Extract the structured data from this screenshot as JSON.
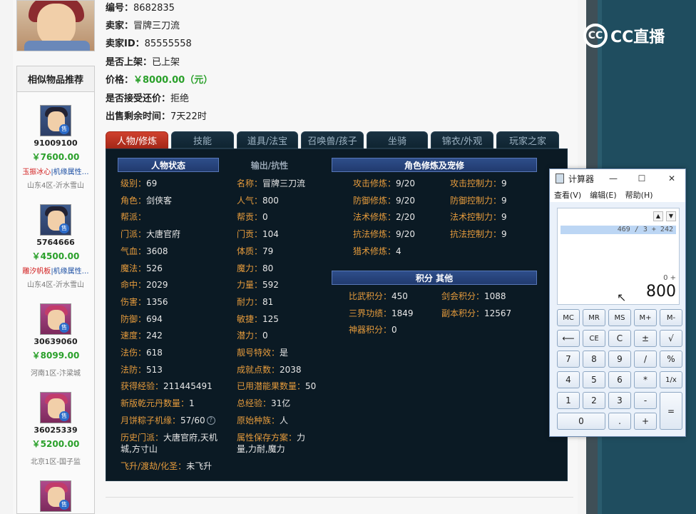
{
  "seller_info": {
    "id_label": "编号：",
    "id_value": "8682835",
    "seller_label": "卖家：",
    "seller_value": "冒牌三刀流",
    "seller_id_label": "卖家ID：",
    "seller_id_value": "85555558",
    "listed_label": "是否上架：",
    "listed_value": "已上架",
    "price_label": "价格：",
    "price_value": "￥8000.00（元）",
    "counter_label": "是否接受还价：",
    "counter_value": "拒绝",
    "time_label": "出售剩余时间：",
    "time_value": "7天22时"
  },
  "similar": {
    "title": "相似物品推荐",
    "items": [
      {
        "id": "91009100",
        "price": "￥7600.00",
        "desc_red": "玉振冰心",
        "desc_blue": "|机缘属性…",
        "server": "山东4区-沂水雪山"
      },
      {
        "id": "5764666",
        "price": "￥4500.00",
        "desc_red": "雕汐帆板",
        "desc_blue": "|机缘属性…",
        "server": "山东4区-沂水雪山"
      },
      {
        "id": "30639060",
        "price": "￥8099.00",
        "desc_red": "",
        "desc_blue": "",
        "server": "河南1区-汴梁城"
      },
      {
        "id": "36025339",
        "price": "￥5200.00",
        "desc_red": "",
        "desc_blue": "",
        "server": "北京1区-国子监"
      }
    ],
    "badge": "售"
  },
  "tabs": [
    "人物/修炼",
    "技能",
    "道具/法宝",
    "召唤兽/孩子",
    "坐骑",
    "锦衣/外观",
    "玩家之家"
  ],
  "sections": {
    "status": "人物状态",
    "output": "输出/抗性",
    "cultivation": "角色修炼及宠修",
    "points": "积分 其他"
  },
  "stats_left": [
    {
      "k": "级别：",
      "v": "69"
    },
    {
      "k": "角色：",
      "v": "剑侠客"
    },
    {
      "k": "帮派：",
      "v": ""
    },
    {
      "k": "门派：",
      "v": "大唐官府"
    },
    {
      "k": "气血：",
      "v": "3608"
    },
    {
      "k": "魔法：",
      "v": "526"
    },
    {
      "k": "命中：",
      "v": "2029"
    },
    {
      "k": "伤害：",
      "v": "1356"
    },
    {
      "k": "防御：",
      "v": "694"
    },
    {
      "k": "速度：",
      "v": "242"
    },
    {
      "k": "法伤：",
      "v": "618"
    },
    {
      "k": "法防：",
      "v": "513"
    },
    {
      "k": "获得经验：",
      "v": "211445491"
    },
    {
      "k": "新版乾元丹数量：",
      "v": "1"
    },
    {
      "k": "月饼粽子机缘：",
      "v": "57/60"
    }
  ],
  "stats_mid": [
    {
      "k": "名称：",
      "v": "冒牌三刀流"
    },
    {
      "k": "人气：",
      "v": "800"
    },
    {
      "k": "帮贡：",
      "v": "0"
    },
    {
      "k": "门贡：",
      "v": "104"
    },
    {
      "k": "体质：",
      "v": "79"
    },
    {
      "k": "魔力：",
      "v": "80"
    },
    {
      "k": "力量：",
      "v": "592"
    },
    {
      "k": "耐力：",
      "v": "81"
    },
    {
      "k": "敏捷：",
      "v": "125"
    },
    {
      "k": "潜力：",
      "v": "0"
    },
    {
      "k": "靓号特效：",
      "v": "是"
    },
    {
      "k": "成就点数：",
      "v": "2038"
    },
    {
      "k": "已用潜能果数量：",
      "v": "50"
    },
    {
      "k": "总经验：",
      "v": "31亿"
    },
    {
      "k": "原始种族：",
      "v": "人"
    }
  ],
  "history": {
    "k": "历史门派：",
    "v1": "大唐官府,天机",
    "v2": "城,方寸山"
  },
  "attr_save": {
    "k": "属性保存方案：",
    "v1": "力",
    "v2": "量,力耐,魔力"
  },
  "ascend": {
    "k": "飞升/渡劫/化圣：",
    "v": "未飞升"
  },
  "cultivation": [
    {
      "k": "攻击修炼：",
      "v": "9/20",
      "k2": "攻击控制力：",
      "v2": "9"
    },
    {
      "k": "防御修炼：",
      "v": "9/20",
      "k2": "防御控制力：",
      "v2": "9"
    },
    {
      "k": "法术修炼：",
      "v": "2/20",
      "k2": "法术控制力：",
      "v2": "9"
    },
    {
      "k": "抗法修炼：",
      "v": "9/20",
      "k2": "抗法控制力：",
      "v2": "9"
    },
    {
      "k": "猎术修炼：",
      "v": "4",
      "k2": "",
      "v2": ""
    }
  ],
  "points": [
    {
      "k": "比武积分：",
      "v": "450",
      "k2": "剑会积分：",
      "v2": "1088"
    },
    {
      "k": "三界功绩：",
      "v": "1849",
      "k2": "副本积分：",
      "v2": "12567"
    },
    {
      "k": "神器积分：",
      "v": "0",
      "k2": "",
      "v2": ""
    }
  ],
  "brand": {
    "logo_text": "CC直播",
    "mark": "CC"
  },
  "calculator": {
    "title": "计算器",
    "menu": [
      "查看(V)",
      "编辑(E)",
      "帮助(H)"
    ],
    "history_expr": "469 / 3 + 242",
    "sub_expr": "0 +",
    "display": "800",
    "buttons": [
      [
        "MC",
        "MR",
        "MS",
        "M+",
        "M-"
      ],
      [
        "⟵",
        "CE",
        "C",
        "±",
        "√"
      ],
      [
        "7",
        "8",
        "9",
        "/",
        "%"
      ],
      [
        "4",
        "5",
        "6",
        "*",
        "1/x"
      ],
      [
        "1",
        "2",
        "3",
        "-",
        "="
      ],
      [
        "0",
        ".",
        "+"
      ]
    ]
  }
}
